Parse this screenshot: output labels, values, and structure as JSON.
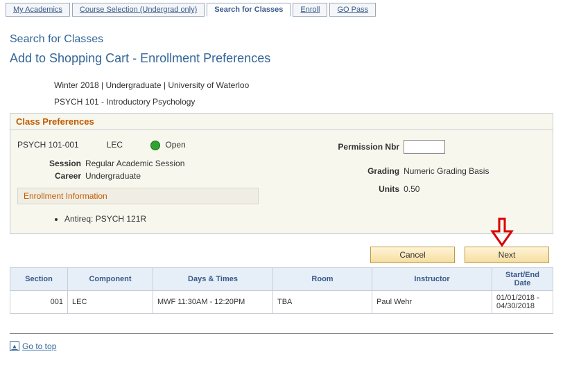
{
  "tabs": {
    "t0": "My Academics",
    "t1": "Course Selection (Undergrad only)",
    "t2": "Search for Classes",
    "t3": "Enroll",
    "t4": "GO Pass"
  },
  "page": {
    "title": "Search for Classes",
    "subtitle": "Add to Shopping Cart - Enrollment Preferences",
    "context_line1": "Winter 2018 | Undergraduate | University of Waterloo",
    "context_line2": "PSYCH  101 - Introductory Psychology"
  },
  "prefs": {
    "header": "Class Preferences",
    "class_code": "PSYCH  101-001",
    "component": "LEC",
    "status_text": "Open",
    "session_label": "Session",
    "session_value": "Regular Academic Session",
    "career_label": "Career",
    "career_value": "Undergraduate",
    "perm_label": "Permission Nbr",
    "perm_value": "",
    "grading_label": "Grading",
    "grading_value": "Numeric Grading Basis",
    "units_label": "Units",
    "units_value": "0.50"
  },
  "enroll_info": {
    "header": "Enrollment Information",
    "bullet1": "Antireq: PSYCH 121R"
  },
  "buttons": {
    "cancel": "Cancel",
    "next": "Next"
  },
  "table": {
    "h0": "Section",
    "h1": "Component",
    "h2": "Days & Times",
    "h3": "Room",
    "h4": "Instructor",
    "h5": "Start/End Date",
    "row0": {
      "section": "001",
      "component": "LEC",
      "days_times": "MWF 11:30AM - 12:20PM",
      "room": "TBA",
      "instructor": "Paul Wehr",
      "dates": "01/01/2018 - 04/30/2018"
    }
  },
  "footer": {
    "go_top": "Go to top"
  }
}
